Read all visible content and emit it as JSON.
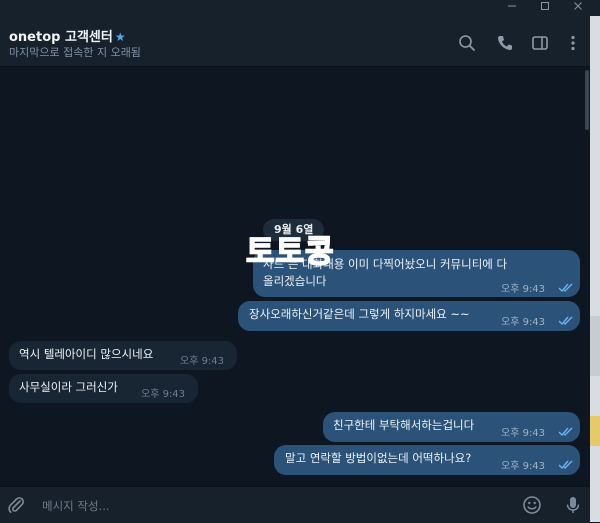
{
  "window": {
    "minimize_icon": "minimize-icon",
    "maximize_icon": "maximize-icon",
    "close_icon": "close-icon"
  },
  "header": {
    "title": "onetop 고객센터",
    "verified_icon": "star-icon",
    "subtitle": "마지막으로 접속한 지 오래됨",
    "actions": [
      "search-icon",
      "phone-icon",
      "sidebar-toggle-icon",
      "more-vertical-icon"
    ]
  },
  "chat": {
    "date_label": "9월 6열",
    "watermark": "토토콩",
    "messages": [
      {
        "direction": "out",
        "lines": [
          "사드   는   대화내용 이미 다찍어놨오니 커뮤니티에 다",
          "올리겠습니다"
        ],
        "time": "오후 9:43",
        "read": true
      },
      {
        "direction": "out",
        "lines": [
          "장사오래하신거같은데 그렇게 하지마세요 ~~"
        ],
        "time": "오후 9:43",
        "read": true
      },
      {
        "direction": "in",
        "lines": [
          "역시 텔레아이디 많으시네요"
        ],
        "time": "오후 9:43"
      },
      {
        "direction": "in",
        "lines": [
          "사무실이라 그러신가"
        ],
        "time": "오후 9:43"
      },
      {
        "direction": "out",
        "lines": [
          "친구한테 부탁해서하는겁니다"
        ],
        "time": "오후 9:43",
        "read": true
      },
      {
        "direction": "out",
        "lines": [
          "말고 연락할 방법이없는데 어떡하나요?"
        ],
        "time": "오후 9:43",
        "read": true
      }
    ]
  },
  "composer": {
    "placeholder": "메시지 작성...",
    "attach_icon": "paperclip-icon",
    "emoji_icon": "emoji-icon",
    "mic_icon": "microphone-icon"
  },
  "colors": {
    "background": "#0e1621",
    "header": "#17212b",
    "outgoing": "#2b5278",
    "incoming": "#182533",
    "accent": "#5aa6ec",
    "watermark": "#e8332a"
  }
}
